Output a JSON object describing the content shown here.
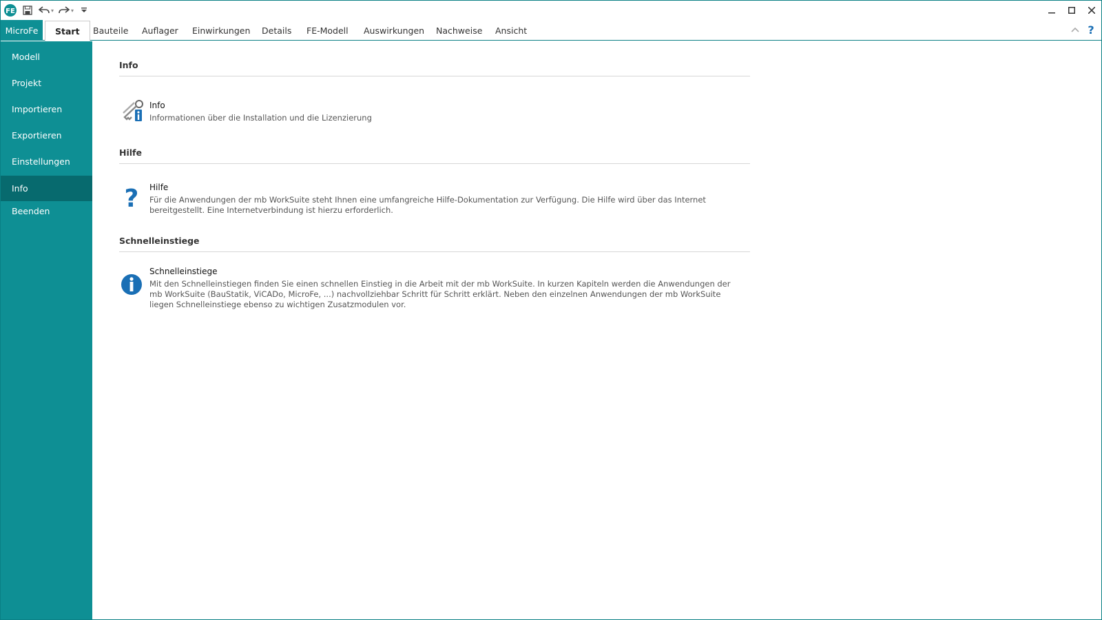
{
  "app": {
    "quick_access": [
      "logo",
      "save-icon",
      "undo-icon",
      "redo-icon",
      "customize-icon"
    ]
  },
  "ribbon": {
    "file_tab": "MicroFe",
    "tabs": [
      "Start",
      "Bauteile",
      "Auflager",
      "Einwirkungen",
      "Details",
      "FE-Modell",
      "Auswirkungen",
      "Nachweise",
      "Ansicht"
    ],
    "active_tab": "Start"
  },
  "sidebar": {
    "items": [
      "Modell",
      "Projekt",
      "Importieren",
      "Exportieren",
      "Einstellungen",
      "Info",
      "Beenden"
    ],
    "active": "Info"
  },
  "sections": [
    {
      "title": "Info",
      "entry": {
        "icon": "keys-info-icon",
        "title": "Info",
        "desc": "Informationen über die Installation und die Lizenzierung"
      }
    },
    {
      "title": "Hilfe",
      "entry": {
        "icon": "question-icon",
        "title": "Hilfe",
        "desc": "Für die Anwendungen der mb WorkSuite steht Ihnen eine umfangreiche Hilfe-Dokumentation zur Verfügung. Die Hilfe wird über das Internet bereitgestellt. Eine Internetverbindung ist hierzu erforderlich."
      }
    },
    {
      "title": "Schnelleinstiege",
      "entry": {
        "icon": "info-circle-icon",
        "title": "Schnelleinstiege",
        "desc": "Mit den Schnelleinstiegen finden Sie einen schnellen Einstieg in die Arbeit mit der mb WorkSuite. In kurzen Kapiteln werden die Anwendungen der mb WorkSuite (BauStatik, ViCADo, MicroFe, ...) nachvollziehbar Schritt für Schritt erklärt. Neben den einzelnen Anwendungen der mb WorkSuite liegen Schnelleinstiege ebenso zu wichtigen Zusatzmodulen vor."
      }
    }
  ],
  "colors": {
    "accent": "#0e8f94",
    "accent_dark": "#076a6e",
    "icon_blue": "#1a6fb5"
  }
}
